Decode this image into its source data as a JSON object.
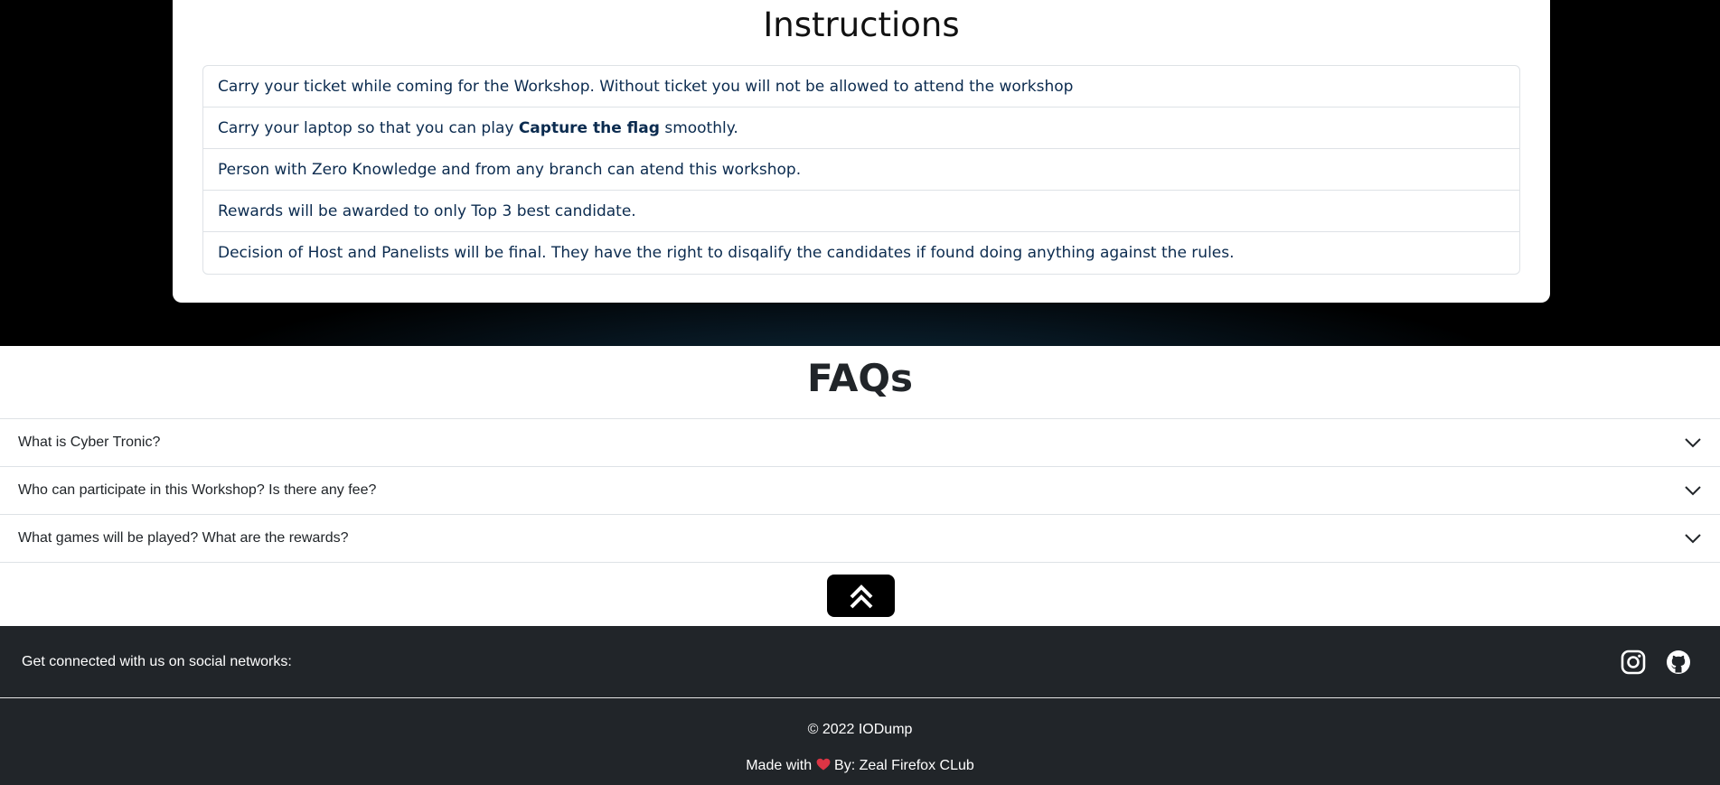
{
  "instructions": {
    "title": "Instructions",
    "items": [
      {
        "text": "Carry your ticket while coming for the Workshop. Without ticket you will not be allowed to attend the workshop"
      },
      {
        "before": "Carry your laptop so that you can play ",
        "bold": "Capture the flag",
        "after": " smoothly."
      },
      {
        "text": "Person with Zero Knowledge and from any branch can atend this workshop."
      },
      {
        "text": "Rewards will be awarded to only Top 3 best candidate."
      },
      {
        "text": "Decision of Host and Panelists will be final. They have the right to disqalify the candidates if found doing anything against the rules."
      }
    ]
  },
  "faqs": {
    "title": "FAQs",
    "items": [
      {
        "question": "What is Cyber Tronic?"
      },
      {
        "question": "Who can participate in this Workshop? Is there any fee?"
      },
      {
        "question": "What games will be played? What are the rewards?"
      }
    ]
  },
  "back_to_top": {
    "icon": "double-chevron-up-icon"
  },
  "footer": {
    "social_text": "Get connected with us on social networks:",
    "social_icons": [
      "instagram-icon",
      "github-icon"
    ],
    "copyright": "© 2022 IODump",
    "made_prefix": "Made with",
    "made_suffix": "By: Zeal Firefox CLub"
  },
  "colors": {
    "hero_background": "#000000",
    "instruction_text": "#0b2b4f",
    "footer_background": "#212529",
    "heart": "#dc3545"
  }
}
